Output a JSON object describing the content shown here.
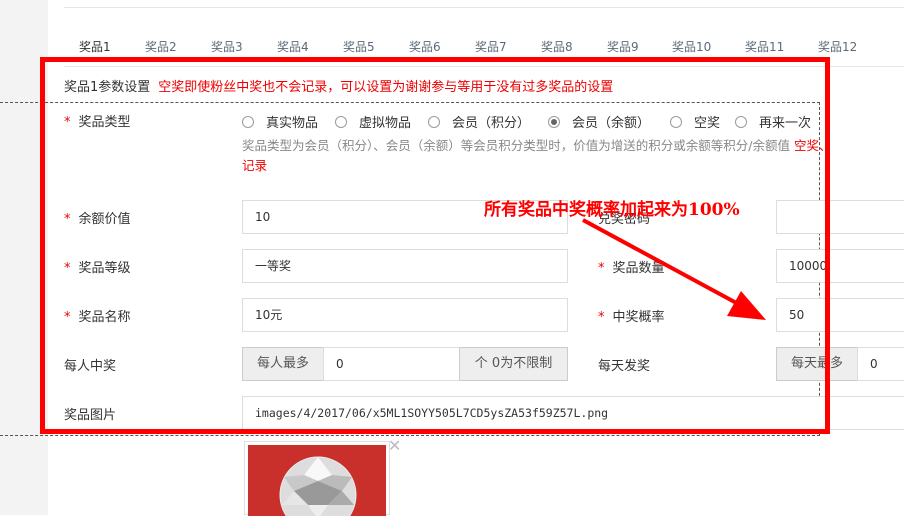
{
  "tabs": [
    "奖品1",
    "奖品2",
    "奖品3",
    "奖品4",
    "奖品5",
    "奖品6",
    "奖品7",
    "奖品8",
    "奖品9",
    "奖品10",
    "奖品11",
    "奖品12"
  ],
  "section": {
    "title": "奖品1参数设置",
    "note": "空奖即使粉丝中奖也不会记录，可以设置为谢谢参与等用于没有过多奖品的设置"
  },
  "prize_type": {
    "label": "奖品类型",
    "options": [
      "真实物品",
      "虚拟物品",
      "会员（积分）",
      "会员（余额）",
      "空奖",
      "再来一次"
    ],
    "selected": "会员（余额）",
    "help": "奖品类型为会员（积分）、会员（余额）等会员积分类型时，价值为增送的积分或余额等积分/余额值",
    "help_red": "空奖、",
    "help_red2": "记录"
  },
  "amount": {
    "label": "余额价值",
    "value": "10"
  },
  "code": {
    "label": "兑奖密码"
  },
  "level": {
    "label": "奖品等级",
    "value": "一等奖"
  },
  "quantity": {
    "label": "奖品数量",
    "value": "10000"
  },
  "name": {
    "label": "奖品名称",
    "value": "10元"
  },
  "probability": {
    "label": "中奖概率",
    "value": "50"
  },
  "per_person": {
    "label": "每人中奖",
    "prefix": "每人最多",
    "value": "0",
    "suffix": "个 0为不限制"
  },
  "per_day": {
    "label": "每天发奖",
    "prefix": "每天最多",
    "value": "0"
  },
  "image": {
    "label": "奖品图片",
    "path": "images/4/2017/06/x5ML1SOYY505L7CD5ysZA53f59Z57L.png",
    "close": "✕"
  },
  "annotation": "所有奖品中奖概率加起来为100%",
  "colors": {
    "annotation": "#ff0000",
    "thumb_bg": "#c9302c"
  }
}
